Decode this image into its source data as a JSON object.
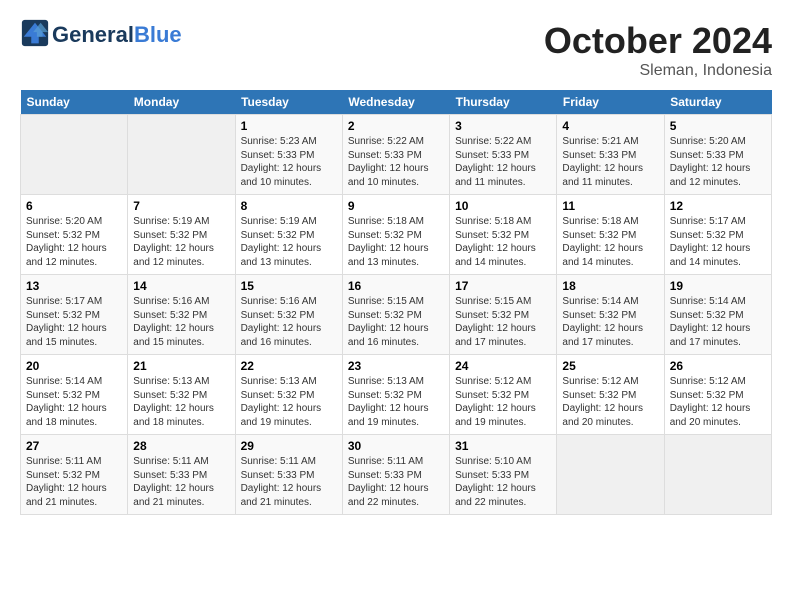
{
  "header": {
    "logo_general": "General",
    "logo_blue": "Blue",
    "month": "October 2024",
    "location": "Sleman, Indonesia"
  },
  "weekdays": [
    "Sunday",
    "Monday",
    "Tuesday",
    "Wednesday",
    "Thursday",
    "Friday",
    "Saturday"
  ],
  "weeks": [
    [
      {
        "day": "",
        "info": ""
      },
      {
        "day": "",
        "info": ""
      },
      {
        "day": "1",
        "info": "Sunrise: 5:23 AM\nSunset: 5:33 PM\nDaylight: 12 hours and 10 minutes."
      },
      {
        "day": "2",
        "info": "Sunrise: 5:22 AM\nSunset: 5:33 PM\nDaylight: 12 hours and 10 minutes."
      },
      {
        "day": "3",
        "info": "Sunrise: 5:22 AM\nSunset: 5:33 PM\nDaylight: 12 hours and 11 minutes."
      },
      {
        "day": "4",
        "info": "Sunrise: 5:21 AM\nSunset: 5:33 PM\nDaylight: 12 hours and 11 minutes."
      },
      {
        "day": "5",
        "info": "Sunrise: 5:20 AM\nSunset: 5:33 PM\nDaylight: 12 hours and 12 minutes."
      }
    ],
    [
      {
        "day": "6",
        "info": "Sunrise: 5:20 AM\nSunset: 5:32 PM\nDaylight: 12 hours and 12 minutes."
      },
      {
        "day": "7",
        "info": "Sunrise: 5:19 AM\nSunset: 5:32 PM\nDaylight: 12 hours and 12 minutes."
      },
      {
        "day": "8",
        "info": "Sunrise: 5:19 AM\nSunset: 5:32 PM\nDaylight: 12 hours and 13 minutes."
      },
      {
        "day": "9",
        "info": "Sunrise: 5:18 AM\nSunset: 5:32 PM\nDaylight: 12 hours and 13 minutes."
      },
      {
        "day": "10",
        "info": "Sunrise: 5:18 AM\nSunset: 5:32 PM\nDaylight: 12 hours and 14 minutes."
      },
      {
        "day": "11",
        "info": "Sunrise: 5:18 AM\nSunset: 5:32 PM\nDaylight: 12 hours and 14 minutes."
      },
      {
        "day": "12",
        "info": "Sunrise: 5:17 AM\nSunset: 5:32 PM\nDaylight: 12 hours and 14 minutes."
      }
    ],
    [
      {
        "day": "13",
        "info": "Sunrise: 5:17 AM\nSunset: 5:32 PM\nDaylight: 12 hours and 15 minutes."
      },
      {
        "day": "14",
        "info": "Sunrise: 5:16 AM\nSunset: 5:32 PM\nDaylight: 12 hours and 15 minutes."
      },
      {
        "day": "15",
        "info": "Sunrise: 5:16 AM\nSunset: 5:32 PM\nDaylight: 12 hours and 16 minutes."
      },
      {
        "day": "16",
        "info": "Sunrise: 5:15 AM\nSunset: 5:32 PM\nDaylight: 12 hours and 16 minutes."
      },
      {
        "day": "17",
        "info": "Sunrise: 5:15 AM\nSunset: 5:32 PM\nDaylight: 12 hours and 17 minutes."
      },
      {
        "day": "18",
        "info": "Sunrise: 5:14 AM\nSunset: 5:32 PM\nDaylight: 12 hours and 17 minutes."
      },
      {
        "day": "19",
        "info": "Sunrise: 5:14 AM\nSunset: 5:32 PM\nDaylight: 12 hours and 17 minutes."
      }
    ],
    [
      {
        "day": "20",
        "info": "Sunrise: 5:14 AM\nSunset: 5:32 PM\nDaylight: 12 hours and 18 minutes."
      },
      {
        "day": "21",
        "info": "Sunrise: 5:13 AM\nSunset: 5:32 PM\nDaylight: 12 hours and 18 minutes."
      },
      {
        "day": "22",
        "info": "Sunrise: 5:13 AM\nSunset: 5:32 PM\nDaylight: 12 hours and 19 minutes."
      },
      {
        "day": "23",
        "info": "Sunrise: 5:13 AM\nSunset: 5:32 PM\nDaylight: 12 hours and 19 minutes."
      },
      {
        "day": "24",
        "info": "Sunrise: 5:12 AM\nSunset: 5:32 PM\nDaylight: 12 hours and 19 minutes."
      },
      {
        "day": "25",
        "info": "Sunrise: 5:12 AM\nSunset: 5:32 PM\nDaylight: 12 hours and 20 minutes."
      },
      {
        "day": "26",
        "info": "Sunrise: 5:12 AM\nSunset: 5:32 PM\nDaylight: 12 hours and 20 minutes."
      }
    ],
    [
      {
        "day": "27",
        "info": "Sunrise: 5:11 AM\nSunset: 5:32 PM\nDaylight: 12 hours and 21 minutes."
      },
      {
        "day": "28",
        "info": "Sunrise: 5:11 AM\nSunset: 5:33 PM\nDaylight: 12 hours and 21 minutes."
      },
      {
        "day": "29",
        "info": "Sunrise: 5:11 AM\nSunset: 5:33 PM\nDaylight: 12 hours and 21 minutes."
      },
      {
        "day": "30",
        "info": "Sunrise: 5:11 AM\nSunset: 5:33 PM\nDaylight: 12 hours and 22 minutes."
      },
      {
        "day": "31",
        "info": "Sunrise: 5:10 AM\nSunset: 5:33 PM\nDaylight: 12 hours and 22 minutes."
      },
      {
        "day": "",
        "info": ""
      },
      {
        "day": "",
        "info": ""
      }
    ]
  ]
}
